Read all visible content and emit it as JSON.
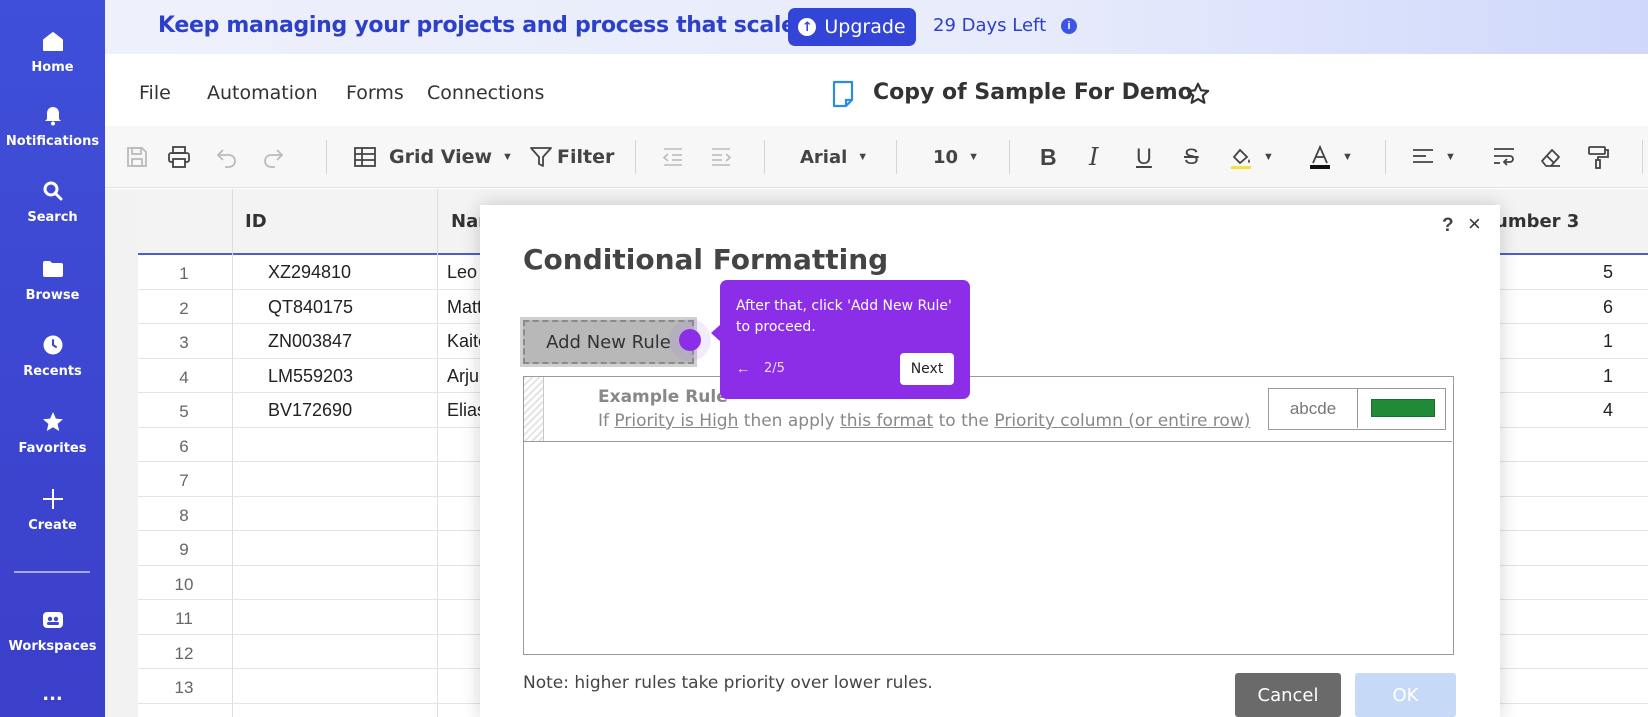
{
  "nav": {
    "items": [
      {
        "label": "Home",
        "icon": "home-icon"
      },
      {
        "label": "Notifications",
        "icon": "bell-icon"
      },
      {
        "label": "Search",
        "icon": "search-icon"
      },
      {
        "label": "Browse",
        "icon": "folder-icon"
      },
      {
        "label": "Recents",
        "icon": "clock-icon"
      },
      {
        "label": "Favorites",
        "icon": "star-icon"
      },
      {
        "label": "Create",
        "icon": "plus-icon"
      },
      {
        "label": "Workspaces",
        "icon": "workspaces-icon"
      }
    ],
    "more": "..."
  },
  "banner": {
    "text": "Keep managing your projects and process that scale.",
    "upgrade_label": "Upgrade",
    "days_left": "29 Days Left"
  },
  "menu": {
    "items": [
      "File",
      "Automation",
      "Forms",
      "Connections"
    ],
    "doc_title": "Copy of Sample For Demo"
  },
  "toolbar": {
    "view_label": "Grid View",
    "filter_label": "Filter",
    "font": "Arial",
    "font_size": "10"
  },
  "grid": {
    "headers": [
      "ID",
      "Nar",
      "umber 3"
    ],
    "rows": [
      {
        "num": "1",
        "id": "XZ294810",
        "name": "Leo",
        "n3": "5"
      },
      {
        "num": "2",
        "id": "QT840175",
        "name": "Matt",
        "n3": "6"
      },
      {
        "num": "3",
        "id": "ZN003847",
        "name": "Kaite",
        "n3": "1"
      },
      {
        "num": "4",
        "id": "LM559203",
        "name": "Arju",
        "n3": "1"
      },
      {
        "num": "5",
        "id": "BV172690",
        "name": "Elias",
        "n3": "4"
      },
      {
        "num": "6",
        "id": "",
        "name": "",
        "n3": ""
      },
      {
        "num": "7",
        "id": "",
        "name": "",
        "n3": ""
      },
      {
        "num": "8",
        "id": "",
        "name": "",
        "n3": ""
      },
      {
        "num": "9",
        "id": "",
        "name": "",
        "n3": ""
      },
      {
        "num": "10",
        "id": "",
        "name": "",
        "n3": ""
      },
      {
        "num": "11",
        "id": "",
        "name": "",
        "n3": ""
      },
      {
        "num": "12",
        "id": "",
        "name": "",
        "n3": ""
      },
      {
        "num": "13",
        "id": "",
        "name": "",
        "n3": ""
      }
    ]
  },
  "dialog": {
    "help": "?",
    "close": "×",
    "title": "Conditional Formatting",
    "add_rule_label": "Add New Rule",
    "example_title": "Example Rule",
    "example_desc": {
      "p1": "If ",
      "link1": "Priority is High",
      "p2": " then apply ",
      "link2": "this format",
      "p3": " to the ",
      "link3": "Priority column (or entire row)"
    },
    "format_sample": "abcde",
    "swatch_color": "#218a37",
    "note": "Note: higher rules take priority over lower rules.",
    "cancel_label": "Cancel",
    "ok_label": "OK"
  },
  "tour": {
    "text": "After that, click 'Add New Rule' to proceed.",
    "back": "←",
    "step": "2/5",
    "next_label": "Next",
    "color": "#8c2ee8"
  }
}
